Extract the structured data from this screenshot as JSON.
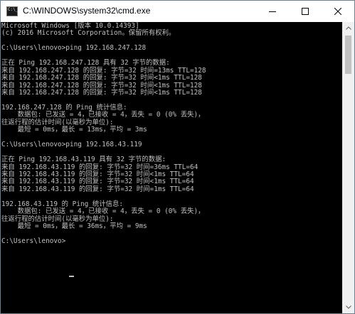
{
  "window": {
    "title": "C:\\WINDOWS\\system32\\cmd.exe",
    "icon_text": "C:\\_",
    "icon": "console-icon"
  },
  "controls": {
    "minimize_icon": "minimize-icon",
    "maximize_icon": "maximize-icon",
    "close_icon": "close-icon"
  },
  "console": {
    "lines": [
      "Microsoft Windows [版本 10.0.14393]",
      "(c) 2016 Microsoft Corporation。保留所有权利。",
      "",
      "C:\\Users\\lenovo>ping 192.168.247.128",
      "",
      "正在 Ping 192.168.247.128 具有 32 字节的数据:",
      "来自 192.168.247.128 的回复: 字节=32 时间=13ms TTL=128",
      "来自 192.168.247.128 的回复: 字节=32 时间<1ms TTL=128",
      "来自 192.168.247.128 的回复: 字节=32 时间<1ms TTL=128",
      "来自 192.168.247.128 的回复: 字节=32 时间<1ms TTL=128",
      "",
      "192.168.247.128 的 Ping 统计信息:",
      "    数据包: 已发送 = 4，已接收 = 4，丢失 = 0 (0% 丢失)，",
      "往返行程的估计时间(以毫秒为单位):",
      "    最短 = 0ms，最长 = 13ms，平均 = 3ms",
      "",
      "C:\\Users\\lenovo>ping 192.168.43.119",
      "",
      "正在 Ping 192.168.43.119 具有 32 字节的数据:",
      "来自 192.168.43.119 的回复: 字节=32 时间=36ms TTL=64",
      "来自 192.168.43.119 的回复: 字节=32 时间<1ms TTL=64",
      "来自 192.168.43.119 的回复: 字节=32 时间<1ms TTL=64",
      "来自 192.168.43.119 的回复: 字节=32 时间=1ms TTL=64",
      "",
      "192.168.43.119 的 Ping 统计信息:",
      "    数据包: 已发送 = 4，已接收 = 4，丢失 = 0 (0% 丢失)，",
      "往返行程的估计时间(以毫秒为单位):",
      "    最短 = 0ms，最长 = 36ms，平均 = 9ms",
      "",
      "C:\\Users\\lenovo>"
    ]
  },
  "scrollbar": {
    "up_icon": "scroll-up-arrow-icon",
    "down_icon": "scroll-down-arrow-icon"
  },
  "colors": {
    "console_bg": "#000000",
    "console_text": "#c0c0c0",
    "titlebar_bg": "#ffffff",
    "border": "#6e7f8f"
  }
}
